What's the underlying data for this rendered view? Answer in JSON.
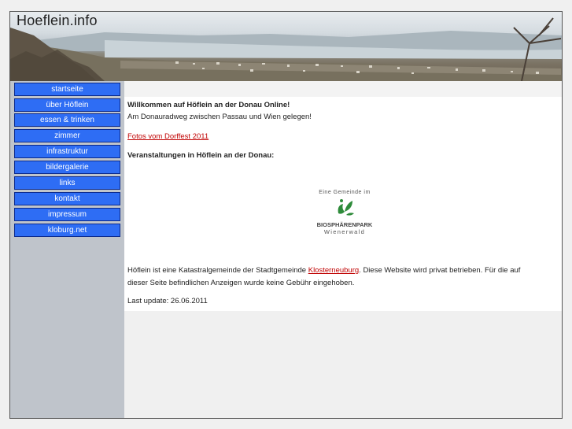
{
  "header": {
    "site_title": "Hoeflein.info"
  },
  "sidebar": {
    "items": [
      {
        "label": "startseite"
      },
      {
        "label": "über Höflein"
      },
      {
        "label": "essen & trinken"
      },
      {
        "label": "zimmer"
      },
      {
        "label": "infrastruktur"
      },
      {
        "label": "bildergalerie"
      },
      {
        "label": "links"
      },
      {
        "label": "kontakt"
      },
      {
        "label": "impressum"
      },
      {
        "label": "kloburg.net"
      }
    ]
  },
  "main": {
    "welcome_heading": "Willkommen auf Höflein an der Donau Online!",
    "welcome_sub": "Am Donauradweg zwischen Passau und Wien gelegen!",
    "photos_link": "Fotos vom Dorffest 2011",
    "events_heading": "Veranstaltungen in Höflein an der Donau:",
    "logo": {
      "top_text": "Eine Gemeinde im",
      "name": "BIOSPHÄRENPARK",
      "sub": "Wienerwald",
      "brand_color": "#2e8b3a"
    },
    "info_part1": "Höflein ist eine Katastralgemeinde der Stadtgemeinde ",
    "info_link": "Klosterneuburg",
    "info_part2": ". Diese Website wird privat betrieben. Für die auf",
    "info_line2": "dieser Seite befindlichen Anzeigen wurde keine Gebühr eingehoben.",
    "last_update": "Last update: 26.06.2011"
  },
  "colors": {
    "nav_button": "#2e6df4",
    "nav_border": "#0b2a8c",
    "sidebar": "#bfc4cb",
    "link": "#c00000"
  }
}
